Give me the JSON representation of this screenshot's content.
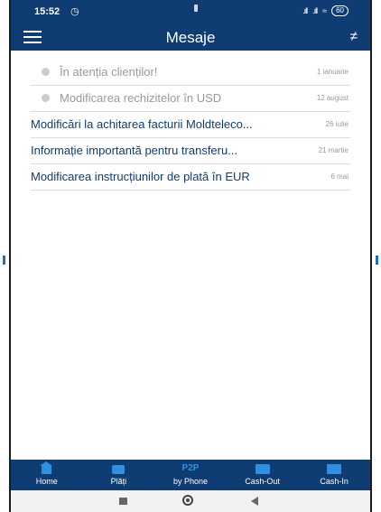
{
  "status_bar": {
    "time": "15:52",
    "battery": "60"
  },
  "header": {
    "title": "Mesaje"
  },
  "messages": [
    {
      "subject": "În atenția clienților!",
      "date": "1 ianuarie",
      "read": true
    },
    {
      "subject": "Modificarea rechizitelor în USD",
      "date": "12 august",
      "read": true
    },
    {
      "subject": "Modificări la achitarea facturii Moldteleco...",
      "date": "26 iulie",
      "read": false
    },
    {
      "subject": "Informație importantă pentru transferu...",
      "date": "21 martie",
      "read": false
    },
    {
      "subject": "Modificarea instrucțiunilor de plată în EUR",
      "date": "6 mai",
      "read": false
    }
  ],
  "tabs": [
    {
      "label": "Home",
      "icon": "home-icon"
    },
    {
      "label": "Plăți",
      "icon": "wallet-icon"
    },
    {
      "label": "by Phone",
      "icon_text": "P2P"
    },
    {
      "label": "Cash-Out",
      "icon": "atm-icon"
    },
    {
      "label": "Cash-In",
      "icon": "atm-icon"
    }
  ],
  "colors": {
    "primary": "#0f3c72",
    "accent": "#2f8fe0",
    "read_text": "#9a9a9a"
  }
}
